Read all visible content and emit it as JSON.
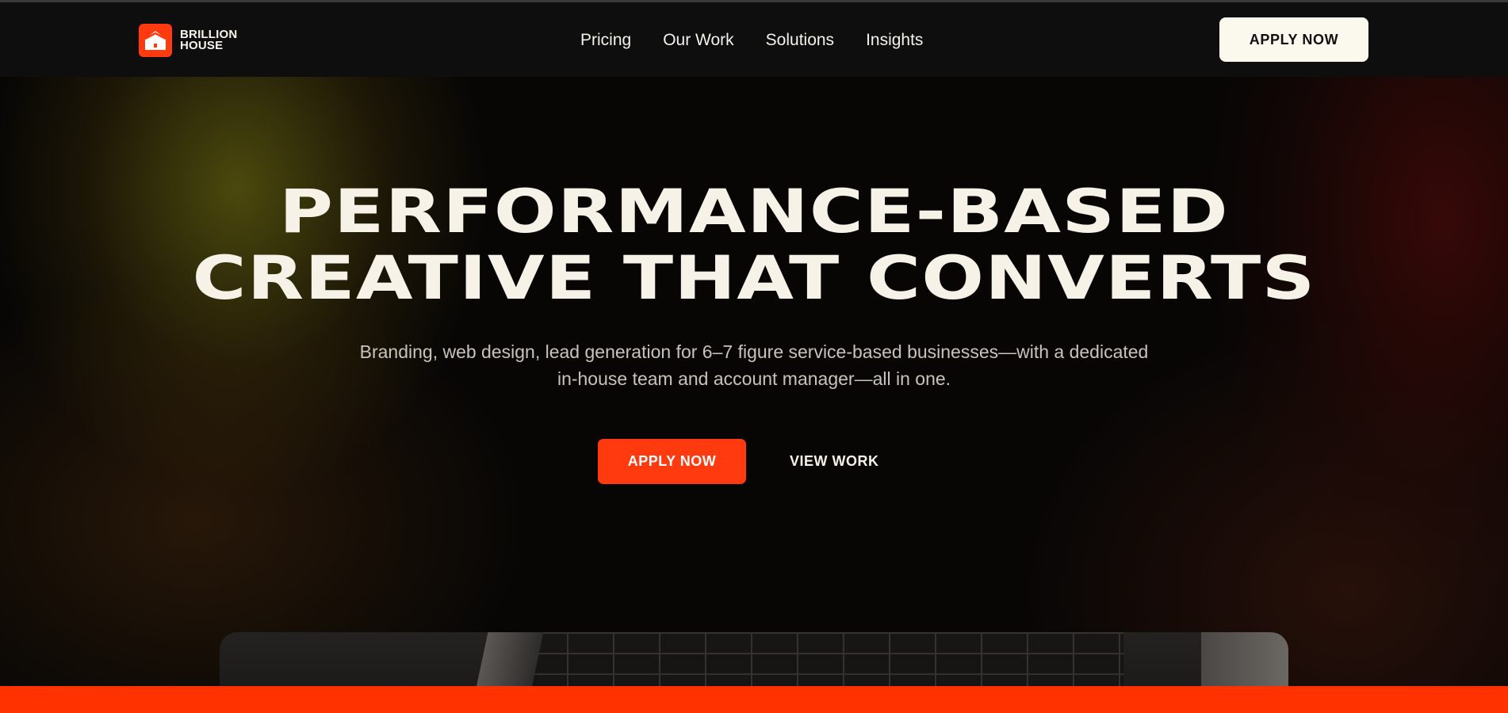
{
  "brand": {
    "name_line1": "BRILLION",
    "name_line2": "HOUSE",
    "accent_color": "#ff3a0f",
    "logo_icon": "house-logo-icon"
  },
  "nav": {
    "links": [
      {
        "label": "Pricing"
      },
      {
        "label": "Our Work"
      },
      {
        "label": "Solutions"
      },
      {
        "label": "Insights"
      }
    ],
    "cta_label": "APPLY NOW"
  },
  "hero": {
    "title_line1": "PERFORMANCE-BASED",
    "title_line2": "CREATIVE THAT CONVERTS",
    "subtitle": "Branding, web design, lead generation for 6–7 figure service-based businesses—with a dedicated in-house team and account manager—all in one.",
    "primary_cta": "APPLY NOW",
    "secondary_cta": "VIEW WORK"
  },
  "colors": {
    "background": "#0a0908",
    "text": "#f6f2e8",
    "cta_light": "#fbf8ee",
    "bottom_bar": "#ff3200"
  }
}
